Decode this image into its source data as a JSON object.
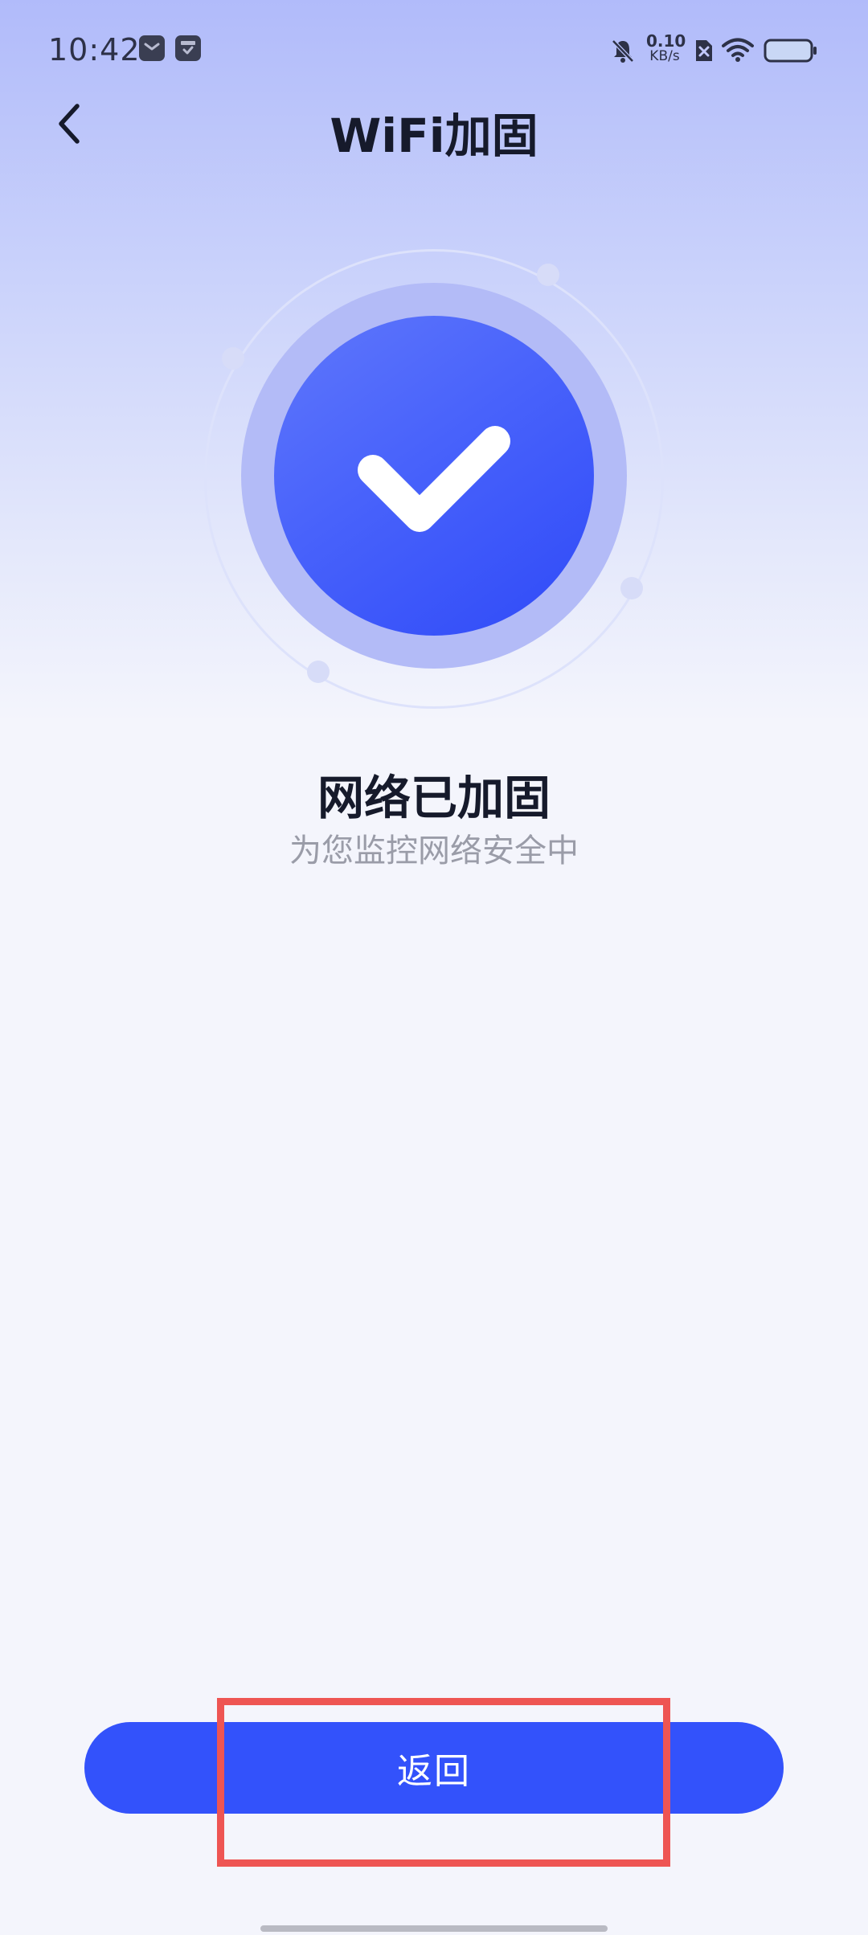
{
  "status_bar": {
    "time": "10:42",
    "net_speed_value": "0.10",
    "net_speed_unit": "KB/s",
    "icons": [
      "mail-icon",
      "box-icon",
      "bell-off-icon",
      "sim-x-icon",
      "wifi-icon",
      "battery-icon"
    ]
  },
  "header": {
    "title": "WiFi加固",
    "back_icon": "chevron-left-icon"
  },
  "result": {
    "icon": "check-icon",
    "title": "网络已加固",
    "subtitle": "为您监控网络安全中"
  },
  "actions": {
    "return_label": "返回"
  },
  "colors": {
    "accent": "#3352fb",
    "highlight": "#ee5553",
    "title_text": "#161a2b",
    "subtitle_text": "#9a9ca8"
  }
}
